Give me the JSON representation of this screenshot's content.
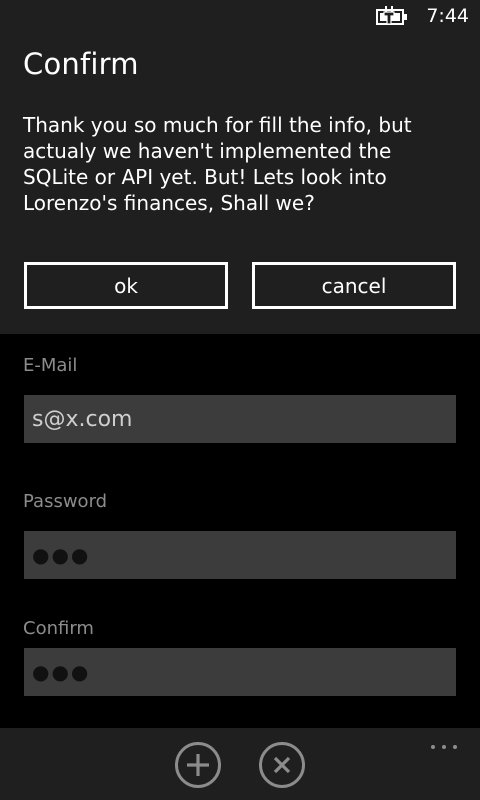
{
  "status_bar": {
    "time": "7:44",
    "battery_icon": "battery-charging-icon"
  },
  "dialog": {
    "title": "Confirm",
    "message": "Thank you so much for fill the info, but actualy we haven't implemented the SQLite or API yet. But! Lets look into Lorenzo's finances, Shall we?",
    "ok_label": "ok",
    "cancel_label": "cancel"
  },
  "form": {
    "email_label": "E-Mail",
    "email_value": "s@x.com",
    "password_label": "Password",
    "password_value": "●●●",
    "confirm_label": "Confirm",
    "confirm_value": "●●●"
  },
  "app_bar": {
    "icons": [
      "add-icon",
      "close-icon",
      "more-icon"
    ]
  },
  "colors": {
    "chrome_background": "#1f1f1f",
    "page_background": "#000000",
    "field_background": "#3c3c3c",
    "label_gray": "#8c8c8c",
    "foreground": "#ffffff"
  }
}
